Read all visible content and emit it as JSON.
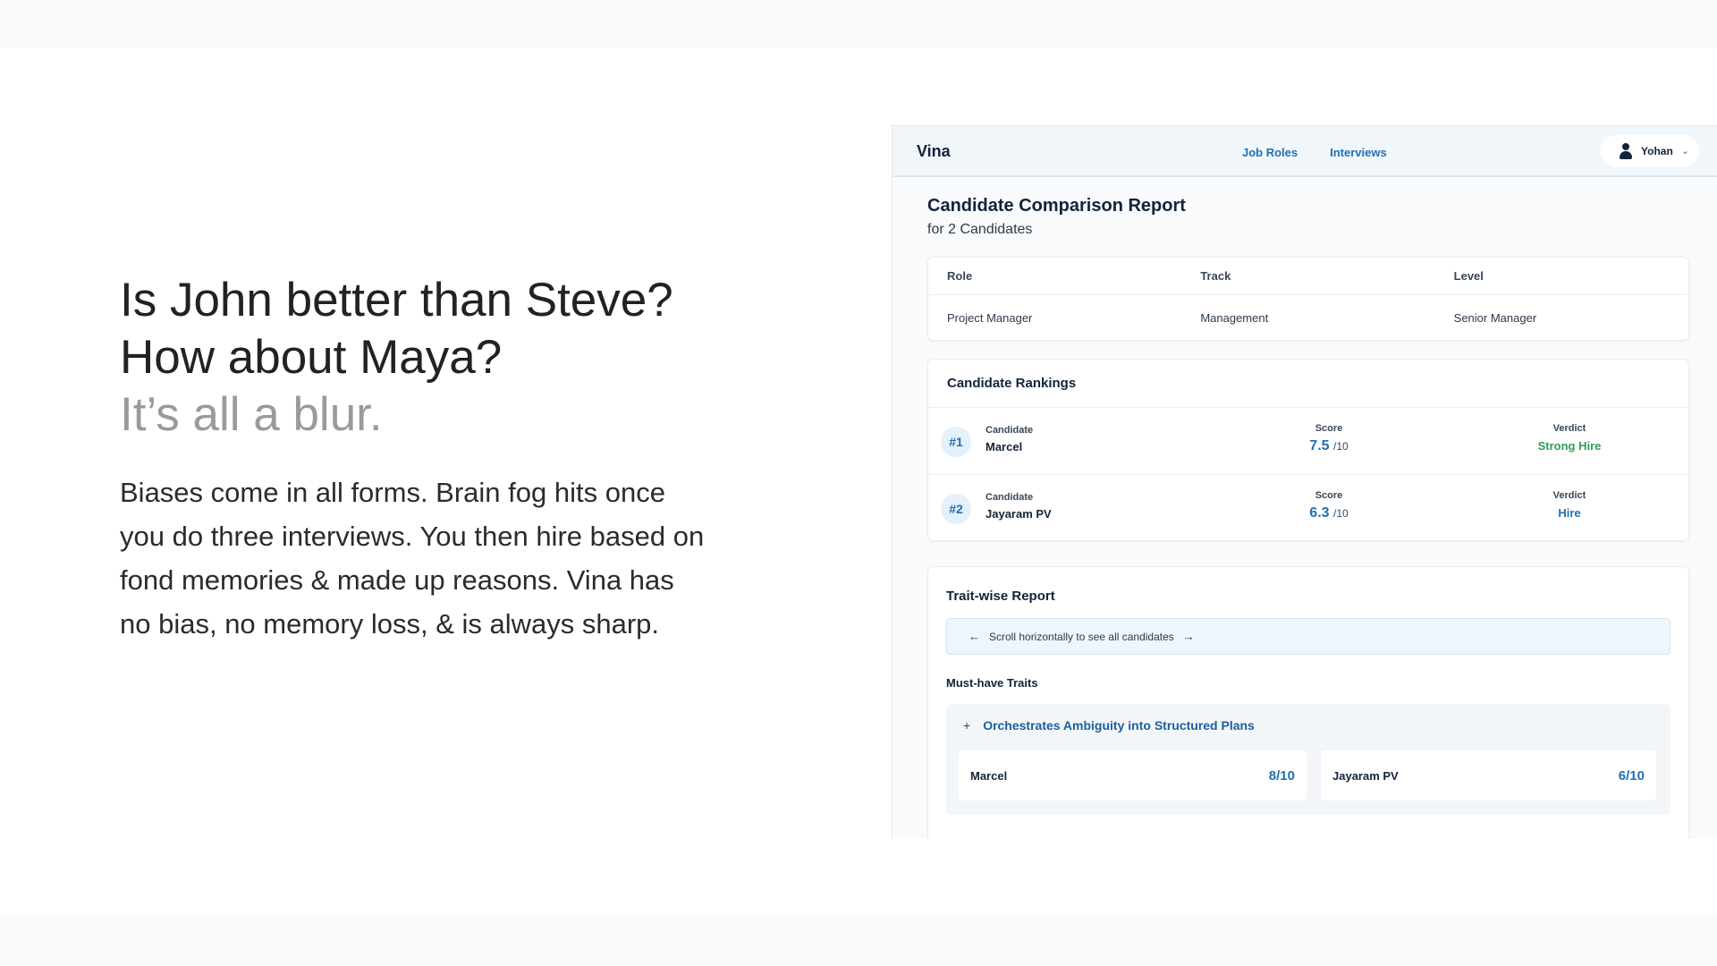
{
  "headline": {
    "line1": "Is John better than Steve?",
    "line2": "How about Maya?",
    "line3": "It’s all a blur."
  },
  "body_text": "Biases come in all forms. Brain fog hits once you do three interviews. You then hire based on fond memories & made up reasons. Vina has no bias, no memory loss, & is always sharp.",
  "app": {
    "brand": "Vina",
    "nav": {
      "job_roles": "Job Roles",
      "interviews": "Interviews"
    },
    "user": {
      "name": "Yohan",
      "icon": "user-icon",
      "dropdown_icon": "chevron-down-icon"
    },
    "report": {
      "title": "Candidate Comparison Report",
      "subtitle": "for 2 Candidates"
    },
    "role_table": {
      "headers": [
        "Role",
        "Track",
        "Level"
      ],
      "values": [
        "Project Manager",
        "Management",
        "Senior Manager"
      ]
    },
    "rankings": {
      "title": "Candidate Rankings",
      "candidate_label": "Candidate",
      "score_label": "Score",
      "verdict_label": "Verdict",
      "rows": [
        {
          "rank": "#1",
          "name": "Marcel",
          "score": "7.5",
          "out_of": "/10",
          "verdict": "Strong Hire",
          "verdict_color": "#2e9e56"
        },
        {
          "rank": "#2",
          "name": "Jayaram PV",
          "score": "6.3",
          "out_of": "/10",
          "verdict": "Hire",
          "verdict_color": "#1f6fb5"
        }
      ]
    },
    "traits": {
      "title": "Trait-wise Report",
      "scroll_hint": "Scroll horizontally to see all candidates",
      "left_arrow": "←",
      "right_arrow": "→",
      "must_have_title": "Must-have Traits",
      "trait": {
        "expand_icon": "+",
        "name": "Orchestrates Ambiguity into Structured Plans",
        "scores": [
          {
            "name": "Marcel",
            "score": "8/10"
          },
          {
            "name": "Jayaram PV",
            "score": "6/10"
          }
        ]
      }
    }
  }
}
